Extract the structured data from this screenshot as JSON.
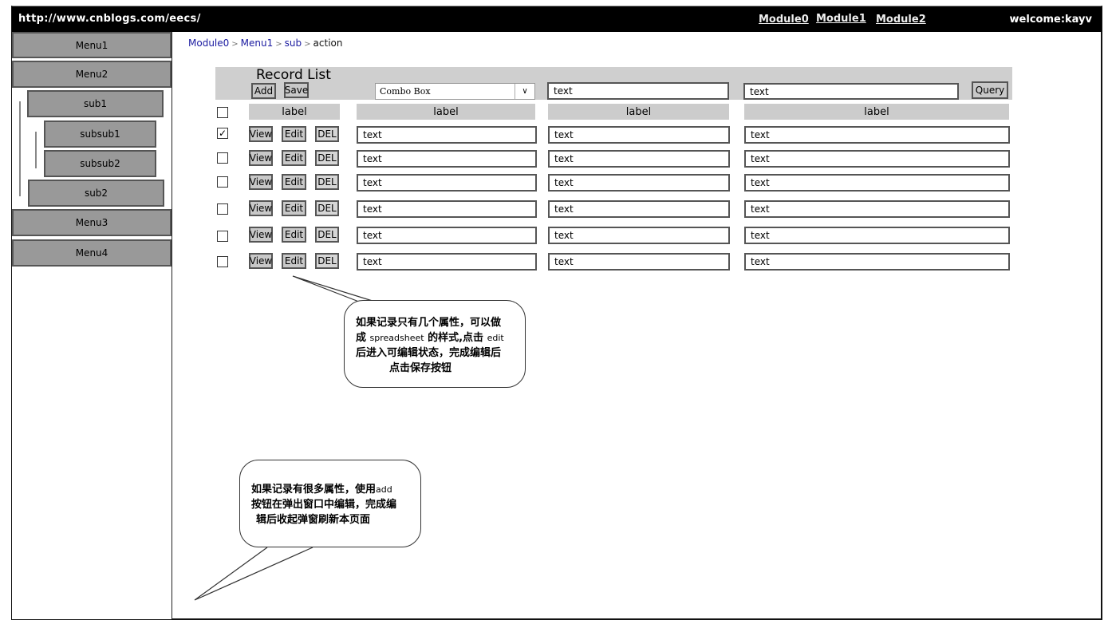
{
  "header": {
    "url": "http://www.cnblogs.com/eecs/",
    "modules": [
      "Module0",
      "Module1",
      "Module2"
    ],
    "welcome": "welcome:kayv"
  },
  "sidebar": {
    "menu1": "Menu1",
    "menu2": "Menu2",
    "sub1": "sub1",
    "subsub1": "subsub1",
    "subsub2": "subsub2",
    "sub2": "sub2",
    "menu3": "Menu3",
    "menu4": "Menu4"
  },
  "breadcrumb": {
    "items": [
      "Module0",
      "Menu1",
      "sub"
    ],
    "current": "action",
    "separator": ">"
  },
  "record_list": {
    "title": "Record List",
    "add_label": "Add",
    "save_label": "Save",
    "combo_value": "Combo Box",
    "filter1": "text",
    "filter2": "text",
    "query_label": "Query",
    "headers": [
      "label",
      "label",
      "label",
      "label"
    ],
    "action_labels": {
      "view": "View",
      "edit": "Edit",
      "del": "DEL"
    },
    "rows": [
      {
        "checked": true,
        "cells": [
          "text",
          "text",
          "text"
        ]
      },
      {
        "checked": false,
        "cells": [
          "text",
          "text",
          "text"
        ]
      },
      {
        "checked": false,
        "cells": [
          "text",
          "text",
          "text"
        ]
      },
      {
        "checked": false,
        "cells": [
          "text",
          "text",
          "text"
        ]
      },
      {
        "checked": false,
        "cells": [
          "text",
          "text",
          "text"
        ]
      },
      {
        "checked": false,
        "cells": [
          "text",
          "text",
          "text"
        ]
      }
    ]
  },
  "notes": {
    "note1": {
      "line1": "如果记录只有几个属性，可以做",
      "line2a": "成 ",
      "line2b": "spreadsheet",
      "line2c": " 的样式,点击 ",
      "line2d": "edit",
      "line3": "后进入可编辑状态，完成编辑后",
      "line4": "点击保存按钮"
    },
    "note2": {
      "line1a": "如果记录有很多属性，使用",
      "line1b": "add",
      "line2": "按钮在弹出窗口中编辑，完成编",
      "line3": "辑后收起弹窗刷新本页面"
    }
  }
}
